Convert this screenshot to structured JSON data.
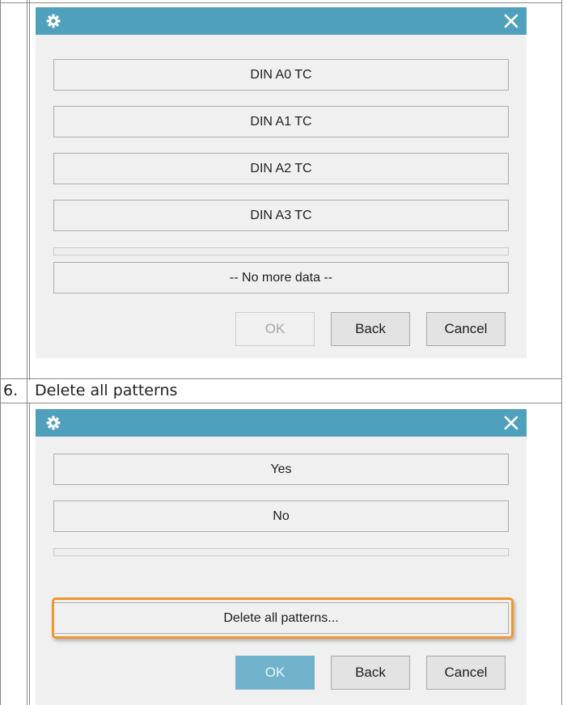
{
  "dialog1": {
    "list_items": [
      "DIN A0 TC",
      "DIN A1 TC",
      "DIN A2 TC",
      "DIN A3 TC"
    ],
    "footer_item": "-- No more data --",
    "buttons": {
      "ok": "OK",
      "back": "Back",
      "cancel": "Cancel"
    }
  },
  "step": {
    "number": "6.",
    "text": "Delete all patterns"
  },
  "dialog2": {
    "list_items": [
      "Yes",
      "No"
    ],
    "highlighted_item": "Delete all patterns...",
    "buttons": {
      "ok": "OK",
      "back": "Back",
      "cancel": "Cancel"
    }
  },
  "colors": {
    "titlebar": "#4fa0bd",
    "highlight": "#f0962e",
    "primary_button": "#71b3cc"
  },
  "icons": {
    "title": "gear-icon",
    "close": "close-icon"
  }
}
